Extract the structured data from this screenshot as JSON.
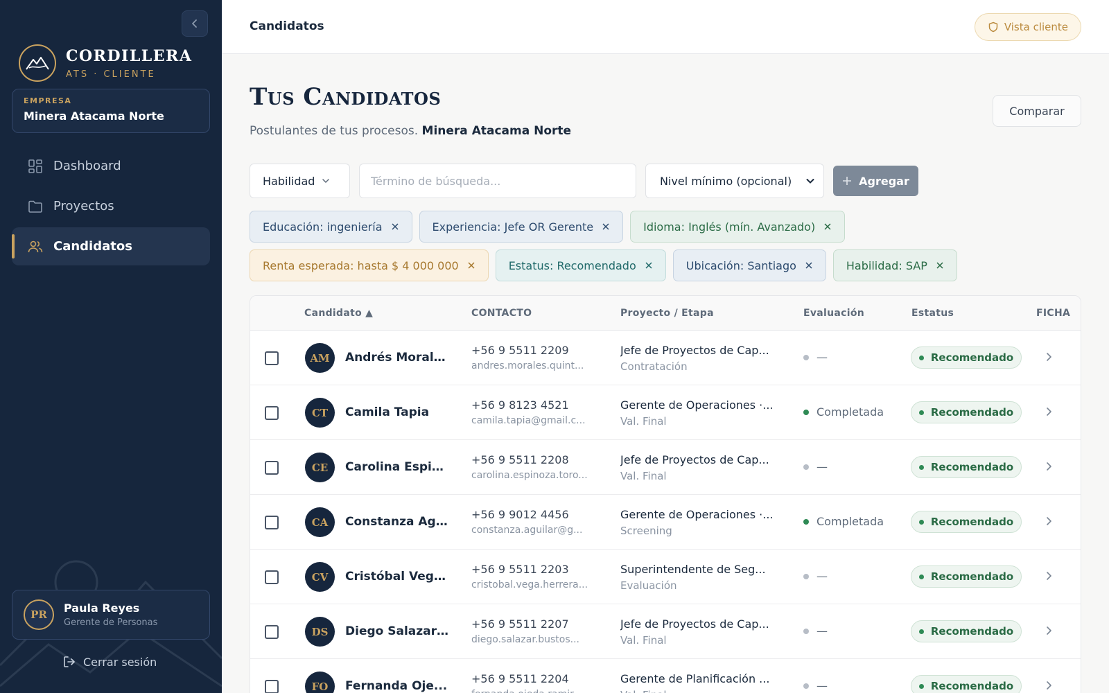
{
  "brand": {
    "name": "CORDILLERA",
    "subtitle": "ATS · CLIENTE"
  },
  "company": {
    "label": "EMPRESA",
    "name": "Minera Atacama Norte"
  },
  "nav": [
    {
      "label": "Dashboard",
      "icon": "dashboard-icon",
      "active": false
    },
    {
      "label": "Proyectos",
      "icon": "folder-icon",
      "active": false
    },
    {
      "label": "Candidatos",
      "icon": "users-icon",
      "active": true
    }
  ],
  "user": {
    "initials": "PR",
    "name": "Paula Reyes",
    "role": "Gerente de Personas"
  },
  "logout_label": "Cerrar sesión",
  "topbar": {
    "title": "Candidatos",
    "client_view_label": "Vista cliente"
  },
  "page": {
    "title": "Tus Candidatos",
    "subtitle": "Postulantes de tus procesos.",
    "subtitle_company": "Minera Atacama Norte",
    "compare_label": "Comparar"
  },
  "filters": {
    "type_selected": "Habilidad",
    "search_placeholder": "Término de búsqueda...",
    "level_selected": "Nivel mínimo (opcional)",
    "add_label": "Agregar"
  },
  "chips": [
    [
      {
        "label": "Educación: ingeniería",
        "tone": "blue"
      },
      {
        "label": "Experiencia: Jefe OR Gerente",
        "tone": "blue"
      },
      {
        "label": "Idioma: Inglés (mín. Avanzado)",
        "tone": "green"
      }
    ],
    [
      {
        "label": "Renta esperada: hasta $ 4 000 000",
        "tone": "gold"
      },
      {
        "label": "Estatus: Recomendado",
        "tone": "teal"
      },
      {
        "label": "Ubicación: Santiago",
        "tone": "blue"
      },
      {
        "label": "Habilidad: SAP",
        "tone": "green"
      }
    ]
  ],
  "table": {
    "headers": {
      "candidate": "Candidato ▲",
      "contact": "CONTACTO",
      "project": "Proyecto / Etapa",
      "evaluation": "Evaluación",
      "status": "Estatus",
      "file": "FICHA"
    },
    "rows": [
      {
        "initials": "AM",
        "name": "Andrés Morale...",
        "phone": "+56 9 5511 2209",
        "email": "andres.morales.quint...",
        "project": "Jefe de Proyectos de Cap...",
        "stage": "Contratación",
        "evaluation": "—",
        "evaluation_done": false,
        "status": "Recomendado"
      },
      {
        "initials": "CT",
        "name": "Camila Tapia",
        "phone": "+56 9 8123 4521",
        "email": "camila.tapia@gmail.c...",
        "project": "Gerente de Operaciones ·...",
        "stage": "Val. Final",
        "evaluation": "Completada",
        "evaluation_done": true,
        "status": "Recomendado"
      },
      {
        "initials": "CE",
        "name": "Carolina Espin...",
        "phone": "+56 9 5511 2208",
        "email": "carolina.espinoza.toro...",
        "project": "Jefe de Proyectos de Cap...",
        "stage": "Val. Final",
        "evaluation": "—",
        "evaluation_done": false,
        "status": "Recomendado"
      },
      {
        "initials": "CA",
        "name": "Constanza Ag...",
        "phone": "+56 9 9012 4456",
        "email": "constanza.aguilar@g...",
        "project": "Gerente de Operaciones ·...",
        "stage": "Screening",
        "evaluation": "Completada",
        "evaluation_done": true,
        "status": "Recomendado"
      },
      {
        "initials": "CV",
        "name": "Cristóbal Vega...",
        "phone": "+56 9 5511 2203",
        "email": "cristobal.vega.herrera...",
        "project": "Superintendente de Seg...",
        "stage": "Evaluación",
        "evaluation": "—",
        "evaluation_done": false,
        "status": "Recomendado"
      },
      {
        "initials": "DS",
        "name": "Diego Salazar ...",
        "phone": "+56 9 5511 2207",
        "email": "diego.salazar.bustos...",
        "project": "Jefe de Proyectos de Cap...",
        "stage": "Val. Final",
        "evaluation": "—",
        "evaluation_done": false,
        "status": "Recomendado"
      },
      {
        "initials": "FO",
        "name": "Fernanda Oje...",
        "phone": "+56 9 5511 2204",
        "email": "fernanda.ojeda.ramir...",
        "project": "Gerente de Planificación ...",
        "stage": "Val. Final",
        "evaluation": "—",
        "evaluation_done": false,
        "status": "Recomendado"
      }
    ]
  },
  "colors": {
    "sidebar_bg": "#16263d",
    "accent_gold": "#c9a25f",
    "status_green": "#2a6b45",
    "eval_done": "#2f8a55",
    "eval_pending": "#b7bdc6"
  }
}
